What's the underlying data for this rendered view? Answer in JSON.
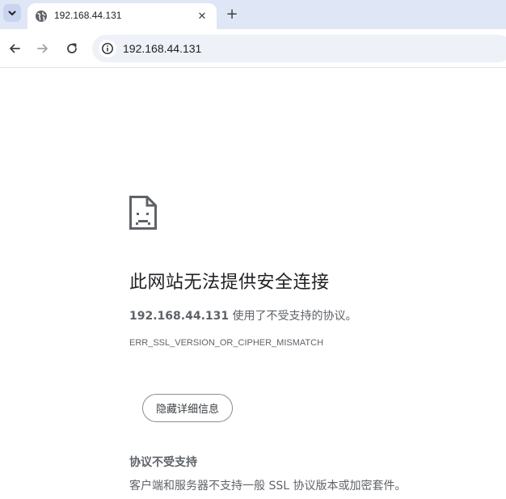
{
  "tab": {
    "title": "192.168.44.131",
    "close_glyph": "✕",
    "new_tab_glyph": "+"
  },
  "toolbar": {
    "url": "192.168.44.131"
  },
  "error": {
    "heading": "此网站无法提供安全连接",
    "host": "192.168.44.131",
    "message": " 使用了不受支持的协议。",
    "code": "ERR_SSL_VERSION_OR_CIPHER_MISMATCH",
    "details_button": "隐藏详细信息",
    "details_heading": "协议不受支持",
    "details_text": "客户端和服务器不支持一般 SSL 协议版本或加密套件。"
  },
  "icons": {
    "tab_search": "chevron-down-icon",
    "favicon": "globe-icon",
    "back": "back-arrow-icon",
    "forward": "forward-arrow-icon",
    "reload": "reload-icon",
    "site_info": "info-icon",
    "error": "sad-page-icon"
  },
  "colors": {
    "tabstrip_bg": "#dfe6f6",
    "omnibox_bg": "#eef1f8",
    "text_primary": "#202124",
    "text_secondary": "#5f6368"
  }
}
